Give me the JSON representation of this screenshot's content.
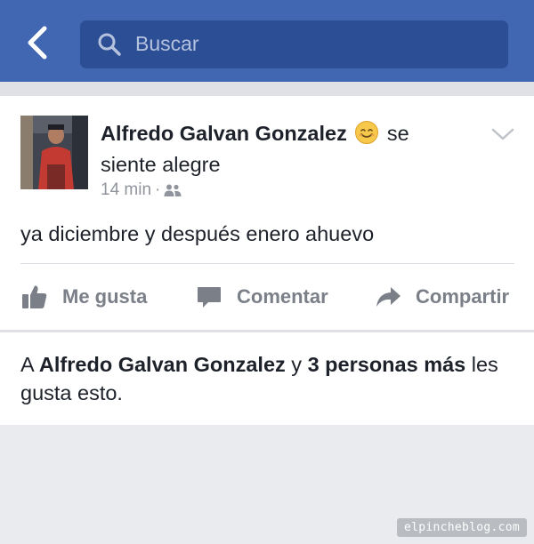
{
  "header": {
    "search_placeholder": "Buscar"
  },
  "post": {
    "author": "Alfredo Galvan Gonzalez",
    "feeling_prefix": "se",
    "feeling": "siente alegre",
    "timestamp": "14 min",
    "separator": "·",
    "audience_icon": "friends-icon",
    "feeling_icon": "smiling-face-emoji",
    "text": "ya diciembre y después enero ahuevo"
  },
  "actions": {
    "like": "Me gusta",
    "comment": "Comentar",
    "share": "Compartir"
  },
  "reactions": {
    "prefix": "A",
    "liker": "Alfredo Galvan Gonzalez",
    "connector": "y",
    "others": "3 personas más",
    "suffix": "les gusta esto."
  },
  "watermark": "elpincheblog.com",
  "colors": {
    "header_bg": "#4267b2",
    "search_bg": "#2c4e94",
    "text_primary": "#1d2129",
    "text_secondary": "#90949c",
    "action_gray": "#7a7f88"
  }
}
